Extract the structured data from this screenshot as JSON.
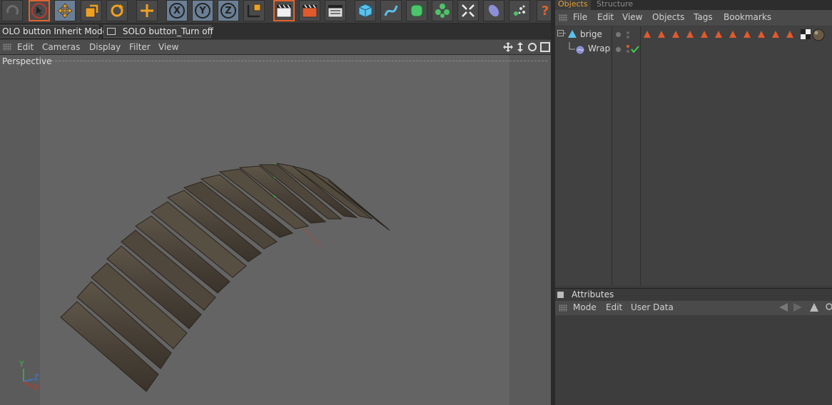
{
  "solo_bar": {
    "inherit_label": "OLO button Inherit Mode",
    "turnoff_label": "SOLO button_Turn off"
  },
  "viewport": {
    "menu": [
      "Edit",
      "Cameras",
      "Display",
      "Filter",
      "View"
    ],
    "label": "Perspective",
    "axis_labels": {
      "y": "Y",
      "z": "Z",
      "x": "X"
    }
  },
  "object_manager": {
    "tabs": {
      "active": "Objects",
      "inactive": "Structure"
    },
    "menu": [
      "File",
      "Edit",
      "View",
      "Objects",
      "Tags",
      "Bookmarks"
    ],
    "objects": [
      {
        "name": "brige"
      },
      {
        "name": "Wrap"
      }
    ]
  },
  "attributes": {
    "title": "Attributes",
    "menu": [
      "Mode",
      "Edit",
      "User Data"
    ]
  },
  "toolbar": {
    "icons": [
      "undo-icon",
      "live-selection-icon",
      "move-icon",
      "scale-icon",
      "rotate-icon",
      "move-last-icon",
      "x-axis-icon",
      "y-axis-icon",
      "z-axis-icon",
      "coordinate-system-icon",
      "render-view-icon",
      "render-picture-icon",
      "render-settings-icon",
      "cube-icon",
      "spline-icon",
      "subdivision-icon",
      "cloner-icon",
      "deformer-icon",
      "environment-icon",
      "particles-icon",
      "help-icon"
    ],
    "axis_letters": [
      "X",
      "Y",
      "Z"
    ],
    "help_glyph": "?"
  },
  "colors": {
    "accent": "#e8a033",
    "tag_orange": "#e05a2b",
    "toolbar_highlight": "#e0632c",
    "selected_button": "#6a7f95"
  }
}
